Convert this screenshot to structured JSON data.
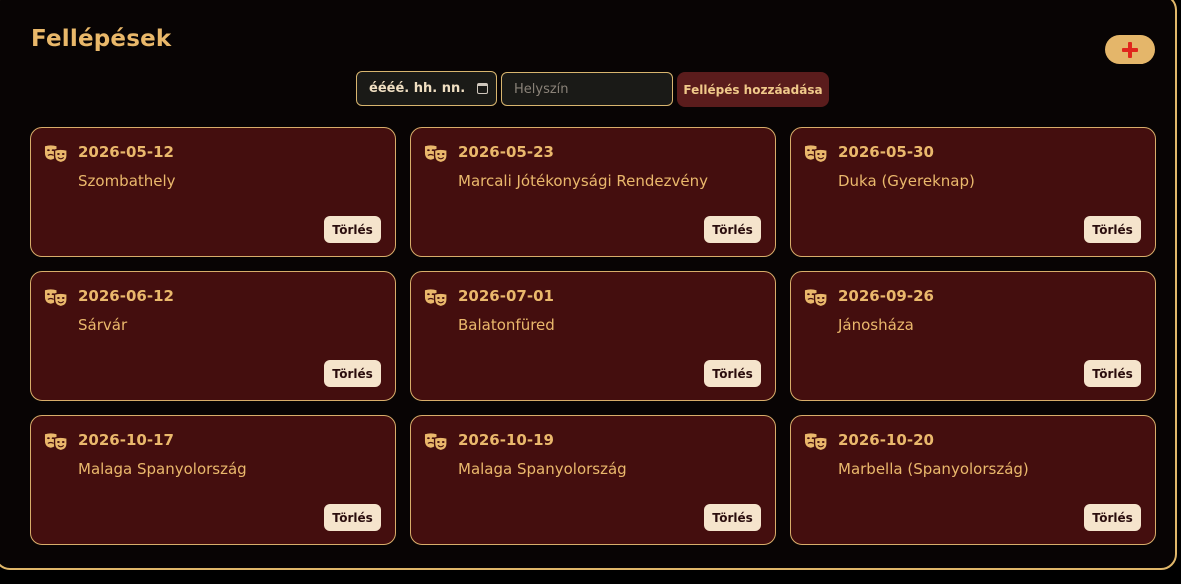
{
  "page": {
    "title": "Fellépések",
    "add_toggle_icon": "plus-icon"
  },
  "form": {
    "date_value": "éééé. hh. nn.",
    "date_icon": "calendar-icon",
    "place_placeholder": "Helyszín",
    "place_value": "",
    "submit_label": "Fellépés hozzáadása"
  },
  "events": [
    {
      "date": "2026-05-12",
      "place": "Szombathely",
      "delete_label": "Törlés"
    },
    {
      "date": "2026-05-23",
      "place": "Marcali Jótékonysági Rendezvény",
      "delete_label": "Törlés"
    },
    {
      "date": "2026-05-30",
      "place": "Duka (Gyereknap)",
      "delete_label": "Törlés"
    },
    {
      "date": "2026-06-12",
      "place": "Sárvár",
      "delete_label": "Törlés"
    },
    {
      "date": "2026-07-01",
      "place": "Balatonfüred",
      "delete_label": "Törlés"
    },
    {
      "date": "2026-09-26",
      "place": "Jánosháza",
      "delete_label": "Törlés"
    },
    {
      "date": "2026-10-17",
      "place": "Malaga Spanyolország",
      "delete_label": "Törlés"
    },
    {
      "date": "2026-10-19",
      "place": "Malaga Spanyolország",
      "delete_label": "Törlés"
    },
    {
      "date": "2026-10-20",
      "place": "Marbella (Spanyolország)",
      "delete_label": "Törlés"
    }
  ],
  "icons": {
    "event": "theater-masks-icon"
  },
  "colors": {
    "background": "#080404",
    "accent": "#e9b86a",
    "card": "#440e0e",
    "submit": "#5a1c1c",
    "add_button": "#e4b66a",
    "plus": "#e0261c"
  }
}
